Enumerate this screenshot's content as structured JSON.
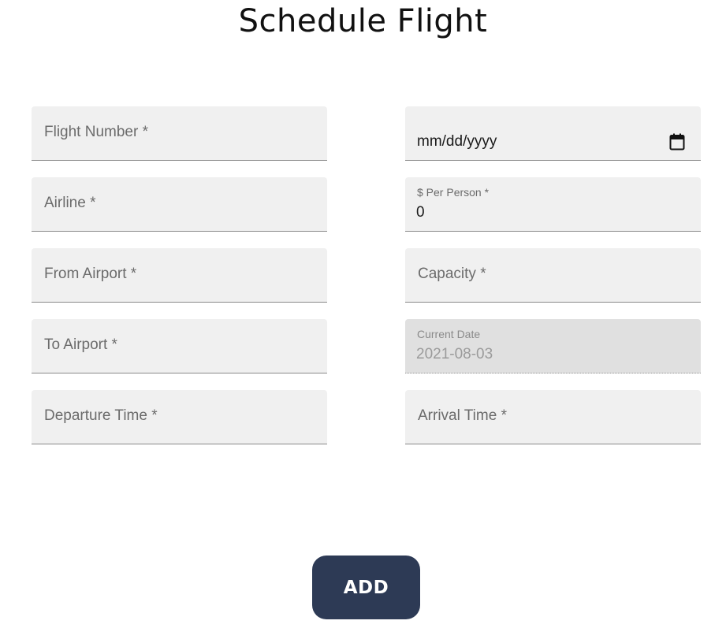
{
  "page": {
    "title": "Schedule Flight"
  },
  "left_fields": [
    {
      "placeholder": "Flight Number *"
    },
    {
      "placeholder": "Airline *"
    },
    {
      "placeholder": "From Airport *"
    },
    {
      "placeholder": "To Airport *"
    },
    {
      "placeholder": "Departure Time *"
    }
  ],
  "right_fields": {
    "date": {
      "placeholder": "mm/dd/yyyy",
      "icon": "calendar-icon"
    },
    "price": {
      "label": "$ Per Person *",
      "value": "0"
    },
    "capacity": {
      "placeholder": "Capacity *"
    },
    "current_date": {
      "label": "Current Date",
      "value": "2021-08-03"
    },
    "arrival": {
      "placeholder": "Arrival Time *"
    }
  },
  "actions": {
    "add_label": "ADD"
  },
  "colors": {
    "button_bg": "#2d3a55",
    "field_bg": "#f0f0f0",
    "disabled_bg": "#e0e0e0"
  }
}
